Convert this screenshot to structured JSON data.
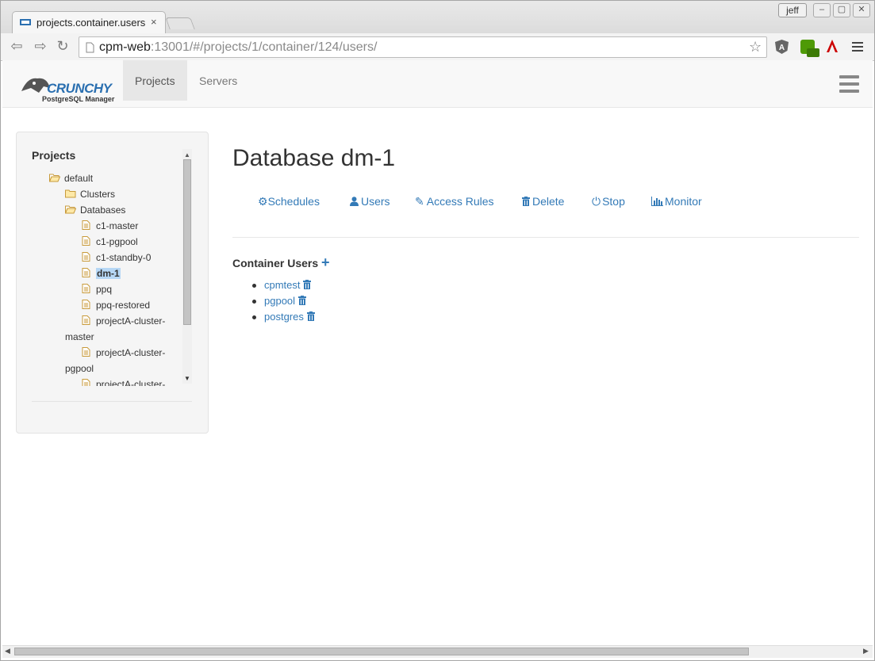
{
  "browser": {
    "tab_title": "projects.container.users",
    "tab_close": "×",
    "user": "jeff",
    "window_buttons": [
      "–",
      "▢",
      "✕"
    ],
    "url_host": "cpm-web",
    "url_rest": ":13001/#/projects/1/container/124/users/"
  },
  "navbar": {
    "logo_text": "CRUNCHY",
    "logo_sub": "PostgreSQL Manager",
    "links": [
      "Projects",
      "Servers"
    ]
  },
  "sidebar": {
    "title": "Projects",
    "tree": [
      {
        "label": "default",
        "type": "folder-open",
        "level": 0
      },
      {
        "label": "Clusters",
        "type": "folder",
        "level": 1
      },
      {
        "label": "Databases",
        "type": "folder-open",
        "level": 1
      },
      {
        "label": "c1-master",
        "type": "file",
        "level": 2
      },
      {
        "label": "c1-pgpool",
        "type": "file",
        "level": 2
      },
      {
        "label": "c1-standby-0",
        "type": "file",
        "level": 2
      },
      {
        "label": "dm-1",
        "type": "file",
        "level": 2,
        "selected": true
      },
      {
        "label": "ppq",
        "type": "file",
        "level": 2
      },
      {
        "label": "ppq-restored",
        "type": "file",
        "level": 2
      },
      {
        "label": "projectA-cluster-",
        "label2": "master",
        "type": "file",
        "level": 2
      },
      {
        "label": "projectA-cluster-",
        "label2": "pgpool",
        "type": "file",
        "level": 2
      },
      {
        "label": "projectA-cluster-",
        "type": "file",
        "level": 2
      }
    ]
  },
  "main": {
    "title": "Database dm-1",
    "actions": [
      "Schedules",
      "Users",
      "Access Rules",
      "Delete",
      "Stop",
      "Monitor"
    ],
    "section_title": "Container Users",
    "users": [
      "cpmtest",
      "pgpool",
      "postgres"
    ]
  },
  "colors": {
    "link": "#337ab7",
    "selected_bg": "#b6d7f5"
  }
}
